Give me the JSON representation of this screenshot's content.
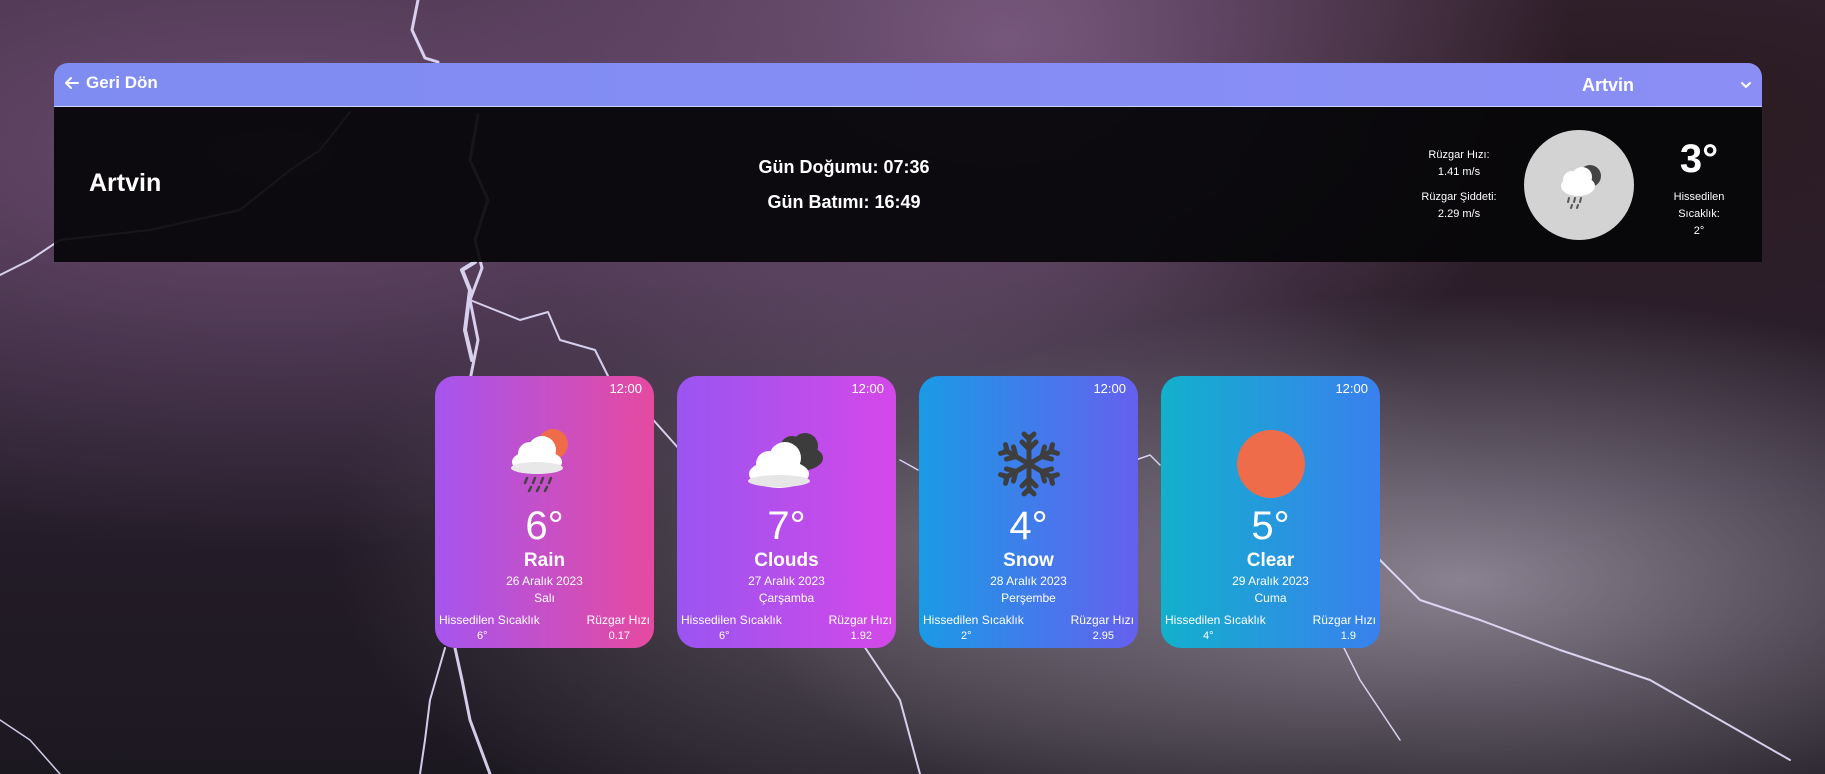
{
  "header": {
    "back_label": "Geri Dön",
    "selected_city": "Artvin"
  },
  "current": {
    "city": "Artvin",
    "sunrise": "Gün Doğumu: 07:36",
    "sunset": "Gün Batımı: 16:49",
    "wind_speed_label": "Rüzgar Hızı:",
    "wind_speed_value": "1.41 m/s",
    "wind_gust_label": "Rüzgar Şiddeti:",
    "wind_gust_value": "2.29 m/s",
    "temperature": "3°",
    "feels_label_1": "Hissedilen",
    "feels_label_2": "Sıcaklık:",
    "feels_value": "2°",
    "icon": "rain-cloud-icon"
  },
  "forecast": [
    {
      "time": "12:00",
      "temp": "6°",
      "desc": "Rain",
      "date": "26 Aralık 2023",
      "day": "Salı",
      "feels_label": "Hissedilen Sıcaklık",
      "feels": "6°",
      "wind_label": "Rüzgar Hızı",
      "wind": "0.17",
      "icon": "rain-sun-icon",
      "gradient": [
        "#a555ee",
        "#e64aa0"
      ]
    },
    {
      "time": "12:00",
      "temp": "7°",
      "desc": "Clouds",
      "date": "27 Aralık 2023",
      "day": "Çarşamba",
      "feels_label": "Hissedilen Sıcaklık",
      "feels": "6°",
      "wind_label": "Rüzgar Hızı",
      "wind": "1.92",
      "icon": "clouds-icon",
      "gradient": [
        "#9a55f0",
        "#d448e8"
      ]
    },
    {
      "time": "12:00",
      "temp": "4°",
      "desc": "Snow",
      "date": "28 Aralık 2023",
      "day": "Perşembe",
      "feels_label": "Hissedilen Sıcaklık",
      "feels": "2°",
      "wind_label": "Rüzgar Hızı",
      "wind": "2.95",
      "icon": "snowflake-icon",
      "gradient": [
        "#1a9ae6",
        "#6560ef"
      ]
    },
    {
      "time": "12:00",
      "temp": "5°",
      "desc": "Clear",
      "date": "29 Aralık 2023",
      "day": "Cuma",
      "feels_label": "Hissedilen Sıcaklık",
      "feels": "4°",
      "wind_label": "Rüzgar Hızı",
      "wind": "1.9",
      "icon": "sun-icon",
      "gradient": [
        "#12b0cc",
        "#3a80ee"
      ]
    }
  ]
}
